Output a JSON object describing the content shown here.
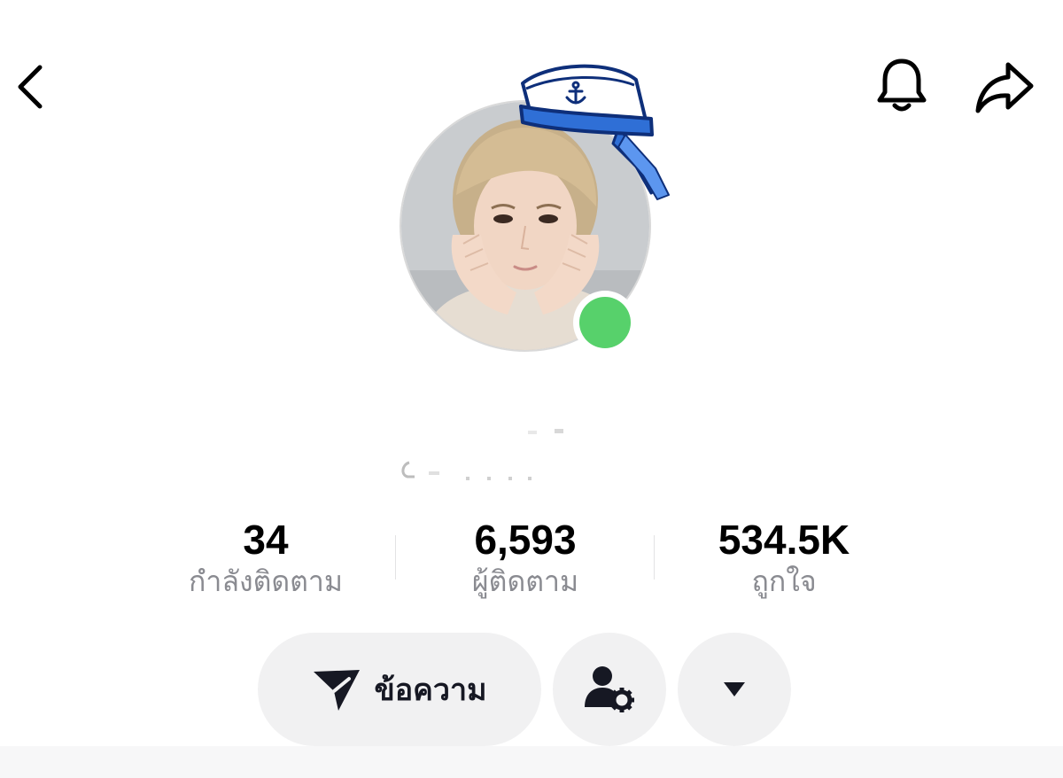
{
  "header": {
    "icons": {
      "back": "chevron-left-icon",
      "notifications": "bell-icon",
      "share": "share-arrow-icon"
    }
  },
  "profile": {
    "avatar_decoration": "sailor-hat",
    "online_status_color": "#57d16b"
  },
  "stats": [
    {
      "value": "34",
      "label": "กำลังติดตาม"
    },
    {
      "value": "6,593",
      "label": "ผู้ติดตาม"
    },
    {
      "value": "534.5K",
      "label": "ถูกใจ"
    }
  ],
  "actions": {
    "message_label": "ข้อความ",
    "message_icon": "paper-plane-icon",
    "friend_settings_icon": "user-gear-icon",
    "more_icon": "caret-down-icon"
  },
  "colors": {
    "button_bg": "#f1f1f2",
    "label_gray": "#8a8b91",
    "text_dark": "#161823"
  }
}
